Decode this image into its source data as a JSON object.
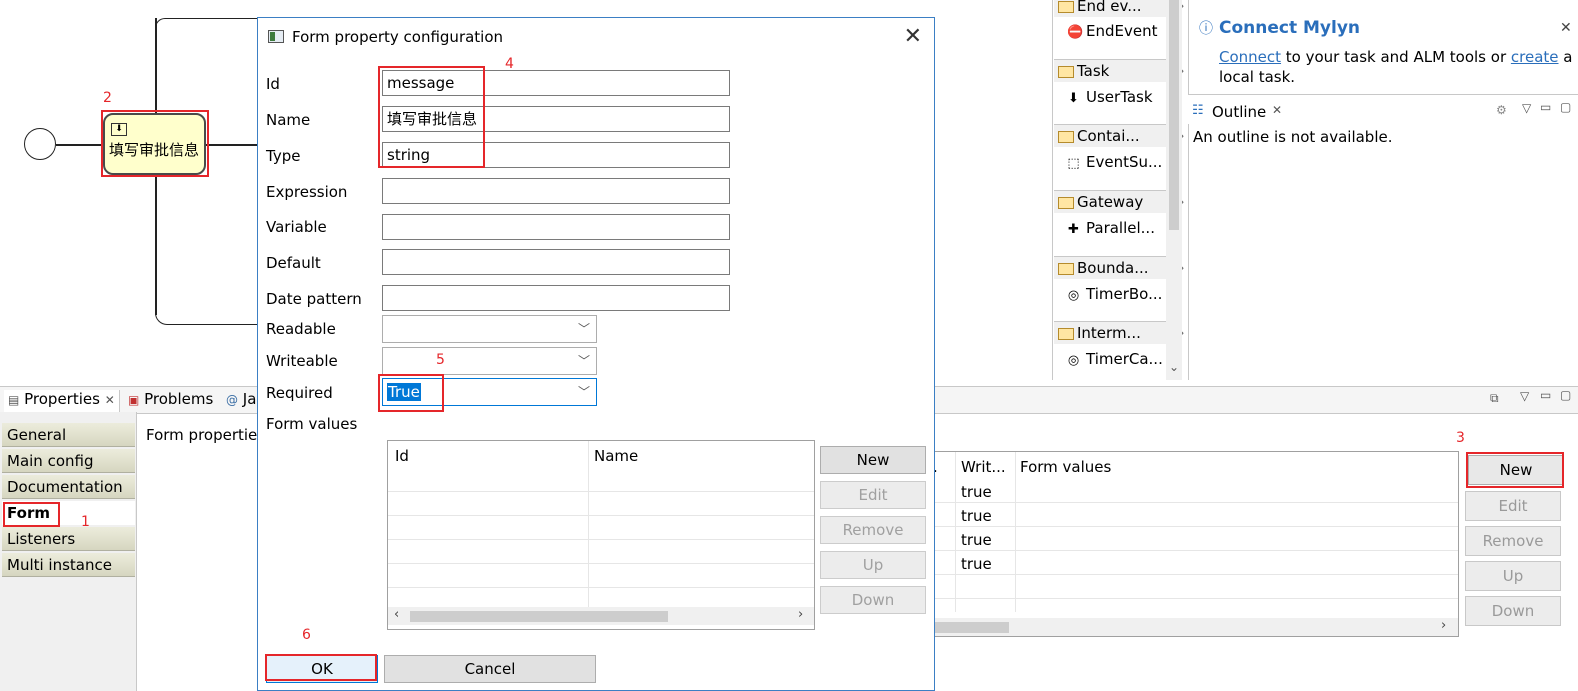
{
  "canvas": {
    "task_label": "填写审批信息"
  },
  "palette": {
    "drawers": [
      {
        "label": "End ev...",
        "item": "EndEvent"
      },
      {
        "label": "Task",
        "item": "UserTask"
      },
      {
        "label": "Contai...",
        "item": "EventSu..."
      },
      {
        "label": "Gateway",
        "item": "Parallel..."
      },
      {
        "label": "Bounda...",
        "item": "TimerBo..."
      },
      {
        "label": "Interm...",
        "item": "TimerCa..."
      }
    ]
  },
  "mylyn": {
    "title": "Connect Mylyn",
    "link_connect": "Connect",
    "text1": " to your task and ALM tools or ",
    "link_create": "create",
    "text2": " a",
    "text3": "local task."
  },
  "outline": {
    "tab_label": "Outline",
    "message": "An outline is not available."
  },
  "bottom": {
    "tabs": [
      "Properties",
      "Problems",
      "Ja"
    ],
    "side_items": [
      "General",
      "Main config",
      "Documentation",
      "Form",
      "Listeners",
      "Multi instance"
    ],
    "section_title": "Form propertie",
    "table_headers": [
      ".",
      "Writ...",
      "Form values"
    ],
    "table_rows": [
      {
        "writ": "true"
      },
      {
        "writ": "true"
      },
      {
        "writ": "true"
      },
      {
        "writ": "true"
      }
    ],
    "buttons": [
      "New",
      "Edit",
      "Remove",
      "Up",
      "Down"
    ]
  },
  "dialog": {
    "title": "Form property configuration",
    "fields": {
      "id_label": "Id",
      "id_value": "message",
      "name_label": "Name",
      "name_value": "填写审批信息",
      "type_label": "Type",
      "type_value": "string",
      "expression_label": "Expression",
      "variable_label": "Variable",
      "default_label": "Default",
      "date_label": "Date pattern",
      "readable_label": "Readable",
      "writeable_label": "Writeable",
      "required_label": "Required",
      "required_value": "True",
      "form_values_label": "Form values"
    },
    "values_table_headers": [
      "Id",
      "Name"
    ],
    "values_buttons": [
      "New",
      "Edit",
      "Remove",
      "Up",
      "Down"
    ],
    "ok_label": "OK",
    "cancel_label": "Cancel"
  },
  "annotations": [
    "1",
    "2",
    "3",
    "4",
    "5",
    "6"
  ]
}
